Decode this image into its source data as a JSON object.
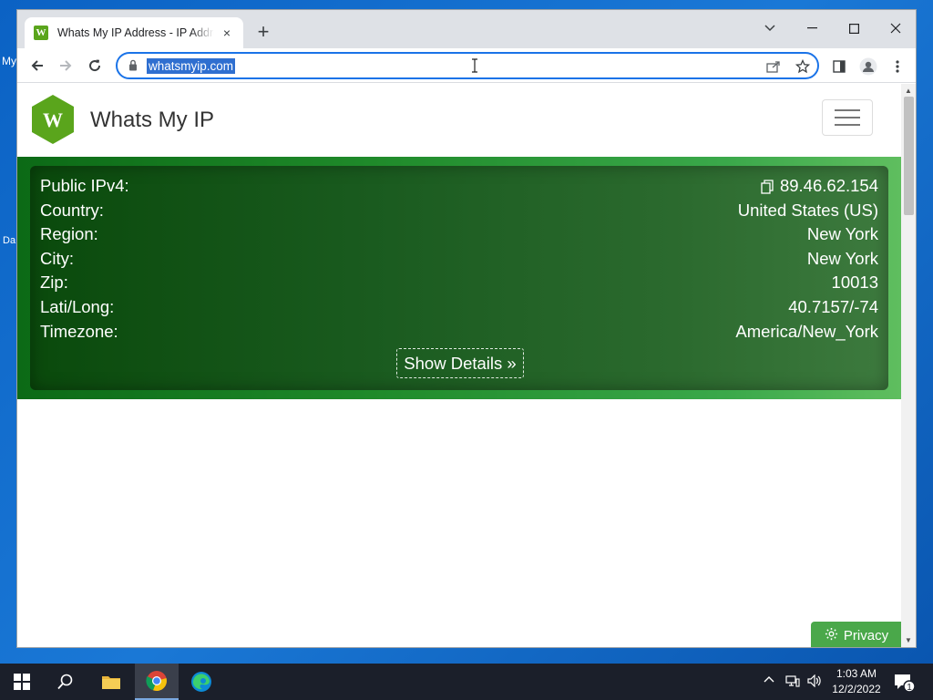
{
  "desktop": {
    "fragments": [
      "My",
      "Da"
    ]
  },
  "browser": {
    "tab_title": "Whats My IP Address - IP Address",
    "tab_close": "×",
    "new_tab": "+",
    "url": "whatsmyip.com"
  },
  "site": {
    "brand_letter": "W",
    "brand_name": "Whats My IP",
    "accent": "#5aa51c"
  },
  "ip_info": {
    "rows": [
      {
        "label": "Public IPv4:",
        "value": "89.46.62.154"
      },
      {
        "label": "Country:",
        "value": "United States (US)"
      },
      {
        "label": "Region:",
        "value": "New York"
      },
      {
        "label": "City:",
        "value": "New York"
      },
      {
        "label": "Zip:",
        "value": "10013"
      },
      {
        "label": "Lati/Long:",
        "value": "40.7157/-74"
      },
      {
        "label": "Timezone:",
        "value": "America/New_York"
      }
    ],
    "details_button": "Show Details »"
  },
  "privacy_button": "Privacy",
  "taskbar": {
    "time": "1:03 AM",
    "date": "12/2/2022",
    "notification_count": "1"
  }
}
